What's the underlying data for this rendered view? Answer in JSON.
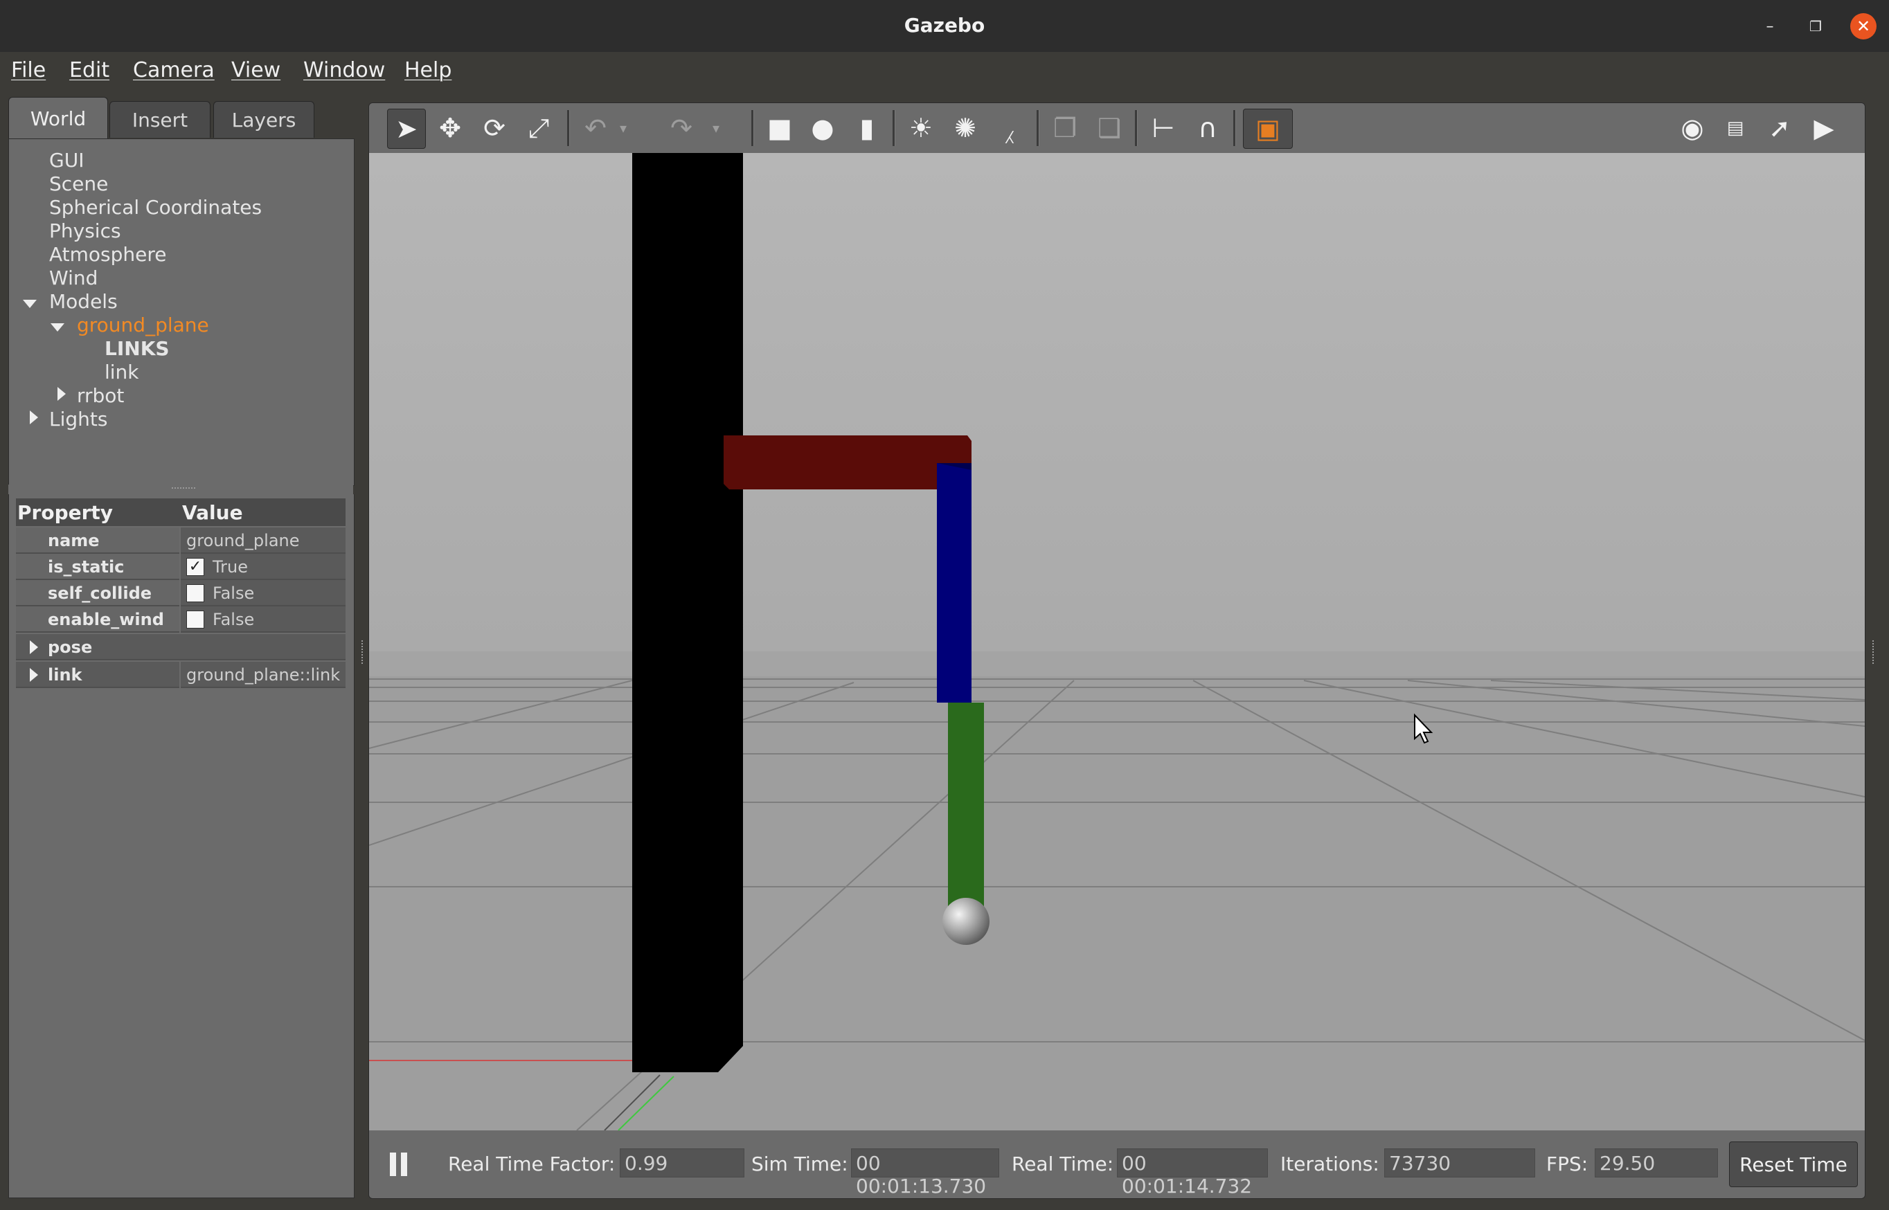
{
  "window": {
    "title": "Gazebo"
  },
  "menu": [
    "File",
    "Edit",
    "Camera",
    "View",
    "Window",
    "Help"
  ],
  "left_panel": {
    "tabs": [
      "World",
      "Insert",
      "Layers"
    ],
    "active_tab": "World",
    "tree": {
      "gui": "GUI",
      "scene": "Scene",
      "spherical": "Spherical Coordinates",
      "physics": "Physics",
      "atmosphere": "Atmosphere",
      "wind": "Wind",
      "models": "Models",
      "ground_plane": "ground_plane",
      "links_header": "LINKS",
      "link": "link",
      "rrbot": "rrbot",
      "lights": "Lights"
    },
    "properties": {
      "col_property": "Property",
      "col_value": "Value",
      "rows": [
        {
          "key": "name",
          "value": "ground_plane"
        },
        {
          "key": "is_static",
          "value": "True",
          "checked": true
        },
        {
          "key": "self_collide",
          "value": "False",
          "checked": false
        },
        {
          "key": "enable_wind",
          "value": "False",
          "checked": false
        },
        {
          "key": "pose",
          "value": ""
        },
        {
          "key": "link",
          "value": "ground_plane::link"
        }
      ]
    }
  },
  "toolbar": {
    "icons": [
      "select-mode-icon",
      "translate-mode-icon",
      "rotate-mode-icon",
      "scale-mode-icon",
      "undo-icon",
      "undo-dropdown-icon",
      "redo-icon",
      "redo-dropdown-icon",
      "box-shape-icon",
      "sphere-shape-icon",
      "cylinder-shape-icon",
      "point-light-icon",
      "spot-light-icon",
      "directional-light-icon",
      "copy-icon",
      "paste-icon",
      "align-icon",
      "snap-icon",
      "view-angle-icon",
      "screenshot-icon",
      "log-icon",
      "plot-icon",
      "video-record-icon"
    ]
  },
  "status": {
    "rtf_label": "Real Time Factor:",
    "rtf_value": "0.99",
    "sim_label": "Sim Time:",
    "sim_value": "00 00:01:13.730",
    "real_label": "Real Time:",
    "real_value": "00 00:01:14.732",
    "iter_label": "Iterations:",
    "iter_value": "73730",
    "fps_label": "FPS:",
    "fps_value": "29.50",
    "reset_label": "Reset Time"
  },
  "colors": {
    "selected_text": "#f28a24",
    "link1": "#000000",
    "link2": "#5a0c08",
    "link3": "#000078",
    "link4": "#2a6a1c",
    "accent_close": "#e95420"
  }
}
